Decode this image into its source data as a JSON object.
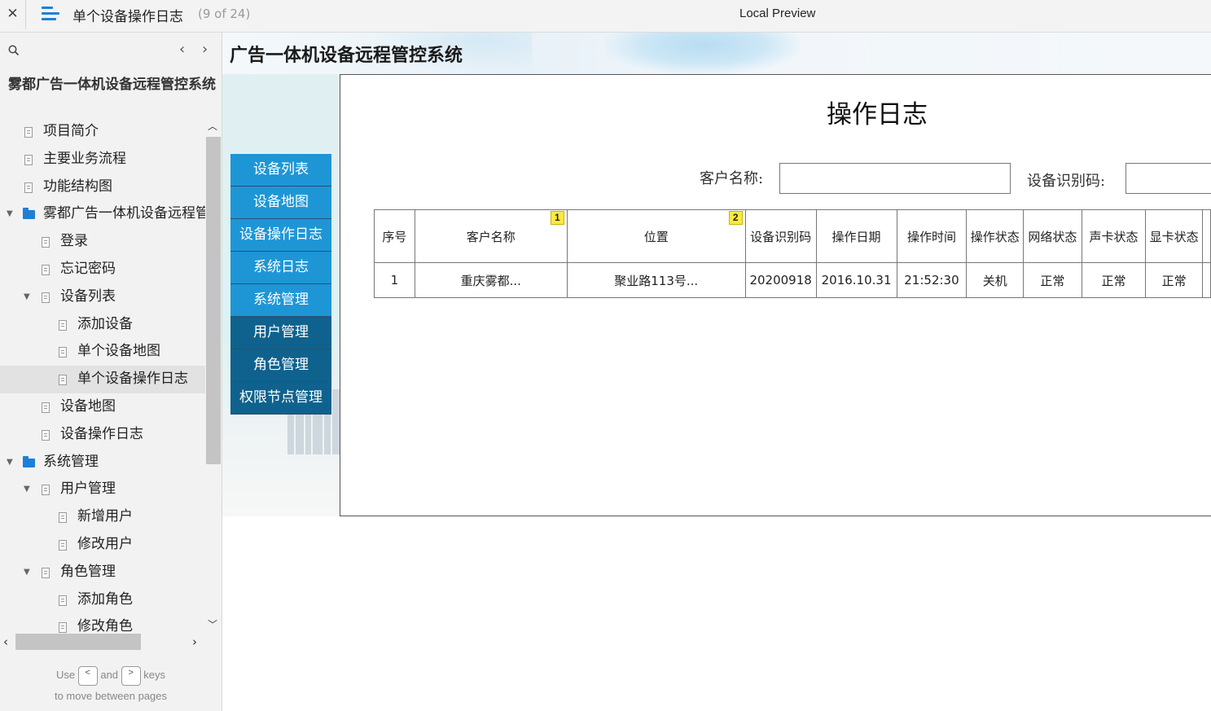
{
  "topbar": {
    "close_glyph": "✕",
    "page_title": "单个设备操作日志",
    "page_count": "(9 of 24)",
    "preview_label": "Local Preview"
  },
  "sidebar": {
    "prev_glyph": "‹",
    "next_glyph": "›",
    "project_title": "雾都广告一体机设备远程管控系统",
    "tree": [
      {
        "label": "项目简介",
        "type": "doc",
        "level": 0
      },
      {
        "label": "主要业务流程",
        "type": "doc",
        "level": 0
      },
      {
        "label": "功能结构图",
        "type": "doc",
        "level": 0
      },
      {
        "label": "雾都广告一体机设备远程管控系统",
        "type": "folder",
        "level": 0,
        "expanded": true
      },
      {
        "label": "登录",
        "type": "doc",
        "level": 1
      },
      {
        "label": "忘记密码",
        "type": "doc",
        "level": 1
      },
      {
        "label": "设备列表",
        "type": "doc",
        "level": 1,
        "expanded": true
      },
      {
        "label": "添加设备",
        "type": "doc",
        "level": 2
      },
      {
        "label": "单个设备地图",
        "type": "doc",
        "level": 2
      },
      {
        "label": "单个设备操作日志",
        "type": "doc",
        "level": 2,
        "active": true
      },
      {
        "label": "设备地图",
        "type": "doc",
        "level": 1
      },
      {
        "label": "设备操作日志",
        "type": "doc",
        "level": 1
      },
      {
        "label": "系统管理",
        "type": "folder",
        "level": 0,
        "expanded": true
      },
      {
        "label": "用户管理",
        "type": "doc",
        "level": 1,
        "expanded": true
      },
      {
        "label": "新增用户",
        "type": "doc",
        "level": 2
      },
      {
        "label": "修改用户",
        "type": "doc",
        "level": 2
      },
      {
        "label": "角色管理",
        "type": "doc",
        "level": 1,
        "expanded": true
      },
      {
        "label": "添加角色",
        "type": "doc",
        "level": 2
      },
      {
        "label": "修改角色",
        "type": "doc",
        "level": 2
      }
    ],
    "help": {
      "use": "Use",
      "key_prev": "<",
      "and": "and",
      "key_next": ">",
      "keys": "keys",
      "line2": "to move between pages"
    }
  },
  "content": {
    "system_title": "广告一体机设备远程管控系统",
    "nav": [
      {
        "label": "设备列表",
        "style": "light"
      },
      {
        "label": "设备地图",
        "style": "light"
      },
      {
        "label": "设备操作日志",
        "style": "light"
      },
      {
        "label": "系统日志",
        "style": "light"
      },
      {
        "label": "系统管理",
        "style": "light"
      },
      {
        "label": "用户管理",
        "style": "dark"
      },
      {
        "label": "角色管理",
        "style": "dark"
      },
      {
        "label": "权限节点管理",
        "style": "dark"
      }
    ],
    "main_title": "操作日志",
    "filters": {
      "customer_label": "客户名称:",
      "customer_value": "",
      "device_label": "设备识别码:",
      "device_value": ""
    },
    "table": {
      "columns": [
        "序号",
        "客户名称",
        "位置",
        "设备识别码",
        "操作日期",
        "操作时间",
        "操作状态",
        "网络状态",
        "声卡状态",
        "显卡状态"
      ],
      "badges": {
        "1": "1",
        "2": "2"
      },
      "rows": [
        [
          "1",
          "重庆雾都...",
          "聚业路113号...",
          "20200918",
          "2016.10.31",
          "21:52:30",
          "关机",
          "正常",
          "正常",
          "正常"
        ]
      ]
    },
    "colors": {
      "nav_light": "#1e96d6",
      "nav_dark": "#0f628d",
      "badge": "#ffe93b",
      "accent": "#1f7fd6"
    }
  }
}
